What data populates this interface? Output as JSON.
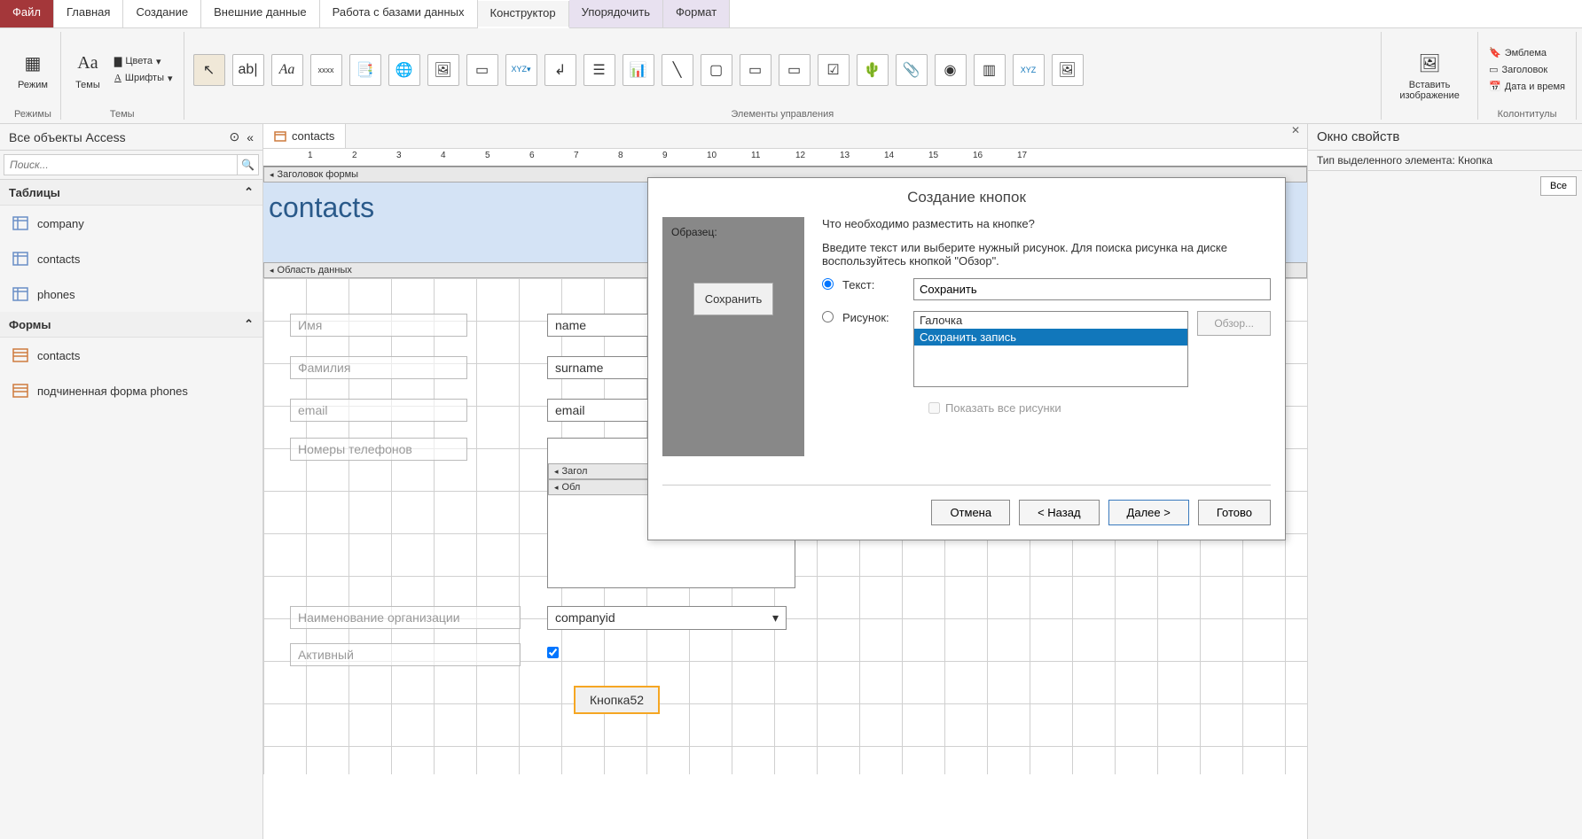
{
  "ribbon": {
    "tabs": {
      "file": "Файл",
      "home": "Главная",
      "create": "Создание",
      "external": "Внешние данные",
      "dbtools": "Работа с базами данных",
      "design": "Конструктор",
      "arrange": "Упорядочить",
      "format": "Формат"
    },
    "groups": {
      "modes": "Режимы",
      "themes": "Темы",
      "controls": "Элементы управления",
      "headerfooter": "Колонтитулы"
    },
    "buttons": {
      "mode": "Режим",
      "themes_btn": "Темы",
      "colors": "Цвета",
      "fonts": "Шрифты",
      "insert_image": "Вставить изображение",
      "emblem": "Эмблема",
      "title": "Заголовок",
      "datetime": "Дата и время"
    }
  },
  "nav": {
    "header": "Все объекты Access",
    "search_placeholder": "Поиск...",
    "groups": {
      "tables": "Таблицы",
      "forms": "Формы"
    },
    "tables": [
      "company",
      "contacts",
      "phones"
    ],
    "forms": [
      "contacts",
      "подчиненная форма phones"
    ]
  },
  "design": {
    "tab_name": "contacts",
    "sections": {
      "header": "Заголовок формы",
      "detail": "Область данных"
    },
    "form_title": "contacts",
    "fields": {
      "name": {
        "label": "Имя",
        "control": "name"
      },
      "surname": {
        "label": "Фамилия",
        "control": "surname"
      },
      "email": {
        "label": "email",
        "control": "email"
      },
      "phones": {
        "label": "Номеры телефонов"
      },
      "company": {
        "label": "Наименование организации",
        "control": "companyid"
      },
      "active": {
        "label": "Активный"
      }
    },
    "subform": {
      "header": "Загол",
      "detail": "Обл"
    },
    "selected_button": "Кнопка52"
  },
  "prop": {
    "header": "Окно свойств",
    "subtitle": "Тип выделенного элемента: Кнопка",
    "all_btn": "Все"
  },
  "wizard": {
    "title": "Создание кнопок",
    "sample_label": "Образец:",
    "sample_button": "Сохранить",
    "q1": "Что необходимо разместить на кнопке?",
    "q2": "Введите текст или выберите нужный рисунок.  Для поиска рисунка на диске воспользуйтесь кнопкой \"Обзор\".",
    "opt_text": "Текст:",
    "opt_image": "Рисунок:",
    "text_value": "Сохранить",
    "list_items": [
      "Галочка",
      "Сохранить запись"
    ],
    "browse": "Обзор...",
    "show_all": "Показать все рисунки",
    "btn_cancel": "Отмена",
    "btn_back": "< Назад",
    "btn_next": "Далее >",
    "btn_finish": "Готово"
  }
}
